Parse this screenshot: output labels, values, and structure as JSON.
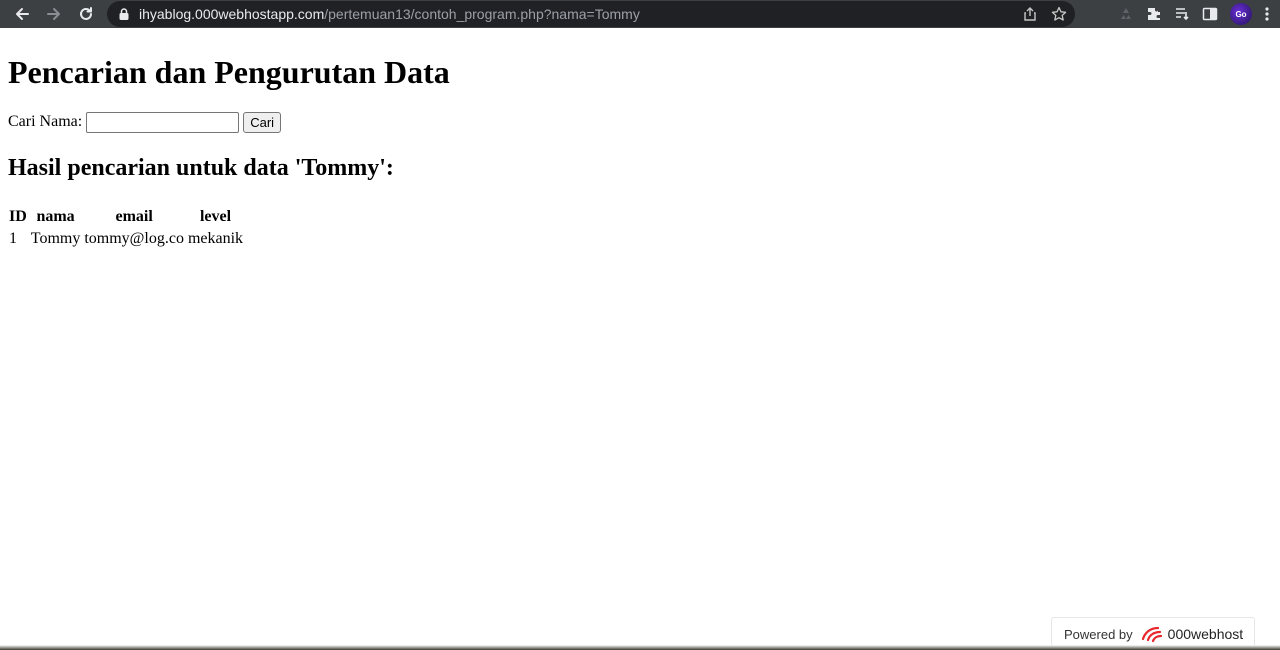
{
  "browser": {
    "url_host": "ihyablog.000webhostapp.com",
    "url_path": "/pertemuan13/contoh_program.php?nama=Tommy",
    "avatar_text": "Go"
  },
  "page": {
    "title": "Pencarian dan Pengurutan Data",
    "search_label": "Cari Nama:",
    "search_value": "",
    "search_button": "Cari",
    "results_heading": "Hasil pencarian untuk data 'Tommy':",
    "table": {
      "headers": [
        "ID",
        "nama",
        "email",
        "level"
      ],
      "rows": [
        [
          "1",
          "Tommy",
          "tommy@log.co",
          "mekanik"
        ]
      ]
    }
  },
  "footer": {
    "powered_label": "Powered by",
    "brand": "000webhost"
  }
}
